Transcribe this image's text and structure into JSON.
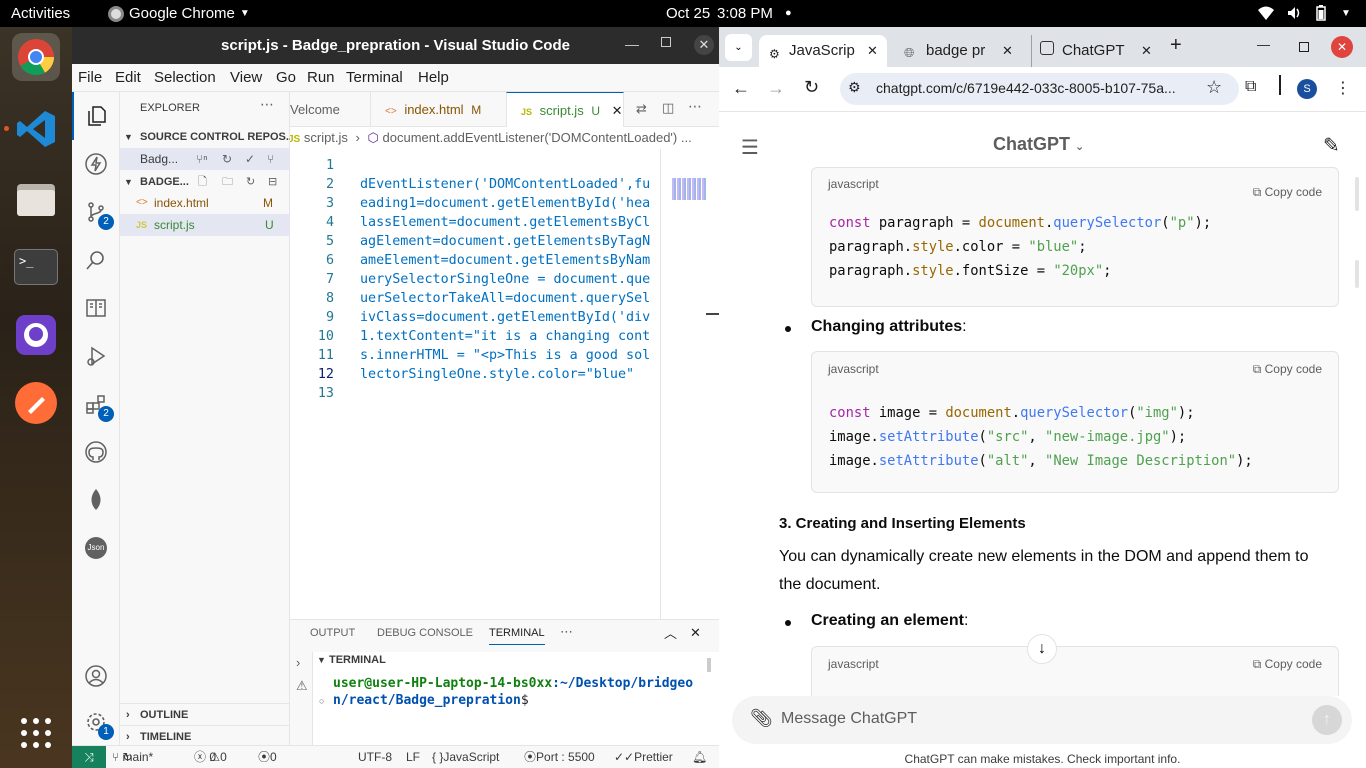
{
  "topbar": {
    "activities": "Activities",
    "app": "Google Chrome",
    "date": "Oct 25",
    "time": "3:08 PM"
  },
  "dock": {
    "items": [
      "chrome-icon",
      "vscode-icon",
      "files-icon",
      "terminal-icon",
      "github-desktop-icon",
      "postman-icon"
    ],
    "grid_label": "Show Applications"
  },
  "vscode": {
    "title": "script.js - Badge_prepration - Visual Studio Code",
    "menu": [
      "File",
      "Edit",
      "Selection",
      "View",
      "Go",
      "Run",
      "Terminal",
      "Help"
    ],
    "activity_badges": {
      "scm": "2",
      "extensions": "2",
      "settings": "1"
    },
    "explorer": {
      "title": "EXPLORER",
      "scm_section": "SOURCE CONTROL REPOS...",
      "scm_repo": "Badg...",
      "folder": "BADGE...",
      "files": [
        {
          "icon": "<>",
          "name": "index.html",
          "status": "M"
        },
        {
          "icon": "JS",
          "name": "script.js",
          "status": "U"
        }
      ],
      "outline": "OUTLINE",
      "timeline": "TIMELINE"
    },
    "tabs": [
      {
        "label": "Velcome"
      },
      {
        "icon": "<>",
        "label": "index.html",
        "status": "M"
      },
      {
        "icon": "JS",
        "label": "script.js",
        "status": "U"
      }
    ],
    "breadcrumb": {
      "file": "script.js",
      "symbol": "document.addEventListener('DOMContentLoaded') ..."
    },
    "code_lines": [
      {
        "n": "1",
        "t": ""
      },
      {
        "n": "2",
        "t": "dEventListener('DOMContentLoaded',fu"
      },
      {
        "n": "3",
        "t": "eading1=document.getElementById('hea"
      },
      {
        "n": "4",
        "t": "lassElement=document.getElementsByCl"
      },
      {
        "n": "5",
        "t": "agElement=document.getElementsByTagN"
      },
      {
        "n": "6",
        "t": "ameElement=document.getElementsByNam"
      },
      {
        "n": "7",
        "t": "uerySelectorSingleOne = document.que"
      },
      {
        "n": "8",
        "t": "uerSelectorTakeAll=document.querySel"
      },
      {
        "n": "9",
        "t": "ivClass=document.getElementById('div"
      },
      {
        "n": "10",
        "t": "1.textContent=\"it is a changing cont"
      },
      {
        "n": "11",
        "t": "s.innerHTML = \"<p>This is a good sol"
      },
      {
        "n": "12",
        "t": "lectorSingleOne.style.color=\"blue\""
      },
      {
        "n": "13",
        "t": ""
      }
    ],
    "panel": {
      "tabs": [
        "OUTPUT",
        "DEBUG CONSOLE",
        "TERMINAL"
      ],
      "terminal_header": "TERMINAL",
      "prompt_user": "user@user-HP-Laptop-14-bs0xx",
      "prompt_path_1": ":~/Desktop/bridgeo",
      "prompt_path_2": "n/react/Badge_prepration",
      "prompt_end": "$"
    },
    "status": {
      "branch": "main*",
      "errors": "0",
      "warnings": "0",
      "ports": "0",
      "encoding": "UTF-8",
      "eol": "LF",
      "language": "JavaScript",
      "port": "Port : 5500",
      "prettier": "Prettier"
    }
  },
  "chrome": {
    "tabs": [
      {
        "label": "JavaScrip",
        "active": true
      },
      {
        "label": "badge pr",
        "active": false
      },
      {
        "label": "ChatGPT",
        "active": false
      }
    ],
    "url": "chatgpt.com/c/6719e442-033c-8005-b107-75a...",
    "profile": "S",
    "chat": {
      "title": "ChatGPT",
      "block1": {
        "lang": "javascript",
        "copy": "Copy code",
        "lines": [
          [
            {
              "c": "kw",
              "t": "const"
            },
            {
              "c": "",
              "t": " paragraph = "
            },
            {
              "c": "ob",
              "t": "document"
            },
            {
              "c": "",
              "t": "."
            },
            {
              "c": "fn",
              "t": "querySelector"
            },
            {
              "c": "",
              "t": "("
            },
            {
              "c": "st",
              "t": "\"p\""
            },
            {
              "c": "",
              "t": ");"
            }
          ],
          [
            {
              "c": "",
              "t": "paragraph."
            },
            {
              "c": "ob",
              "t": "style"
            },
            {
              "c": "",
              "t": ".color = "
            },
            {
              "c": "st",
              "t": "\"blue\""
            },
            {
              "c": "",
              "t": ";"
            }
          ],
          [
            {
              "c": "",
              "t": "paragraph."
            },
            {
              "c": "ob",
              "t": "style"
            },
            {
              "c": "",
              "t": ".fontSize = "
            },
            {
              "c": "st",
              "t": "\"20px\""
            },
            {
              "c": "",
              "t": ";"
            }
          ]
        ]
      },
      "bullet1": "Changing attributes",
      "block2": {
        "lang": "javascript",
        "copy": "Copy code",
        "lines": [
          [
            {
              "c": "kw",
              "t": "const"
            },
            {
              "c": "",
              "t": " image = "
            },
            {
              "c": "ob",
              "t": "document"
            },
            {
              "c": "",
              "t": "."
            },
            {
              "c": "fn",
              "t": "querySelector"
            },
            {
              "c": "",
              "t": "("
            },
            {
              "c": "st",
              "t": "\"img\""
            },
            {
              "c": "",
              "t": ");"
            }
          ],
          [
            {
              "c": "",
              "t": "image."
            },
            {
              "c": "fn",
              "t": "setAttribute"
            },
            {
              "c": "",
              "t": "("
            },
            {
              "c": "st",
              "t": "\"src\""
            },
            {
              "c": "",
              "t": ", "
            },
            {
              "c": "st",
              "t": "\"new-image.jpg\""
            },
            {
              "c": "",
              "t": ");"
            }
          ],
          [
            {
              "c": "",
              "t": "image."
            },
            {
              "c": "fn",
              "t": "setAttribute"
            },
            {
              "c": "",
              "t": "("
            },
            {
              "c": "st",
              "t": "\"alt\""
            },
            {
              "c": "",
              "t": ", "
            },
            {
              "c": "st",
              "t": "\"New Image Description\""
            },
            {
              "c": "",
              "t": ");"
            }
          ]
        ]
      },
      "heading": "3. Creating and Inserting Elements",
      "para_1": "You can dynamically create new elements in the DOM and append them to",
      "para_2": "the document.",
      "bullet2": "Creating an element",
      "block3": {
        "lang": "javascript",
        "copy": "Copy code"
      },
      "input_placeholder": "Message ChatGPT",
      "disclaimer": "ChatGPT can make mistakes. Check important info."
    }
  },
  "colors": {
    "vscode_blue": "#007acc",
    "status_remote": "#16825d",
    "link_blue": "#0070c1",
    "close_red": "#e0443e"
  }
}
